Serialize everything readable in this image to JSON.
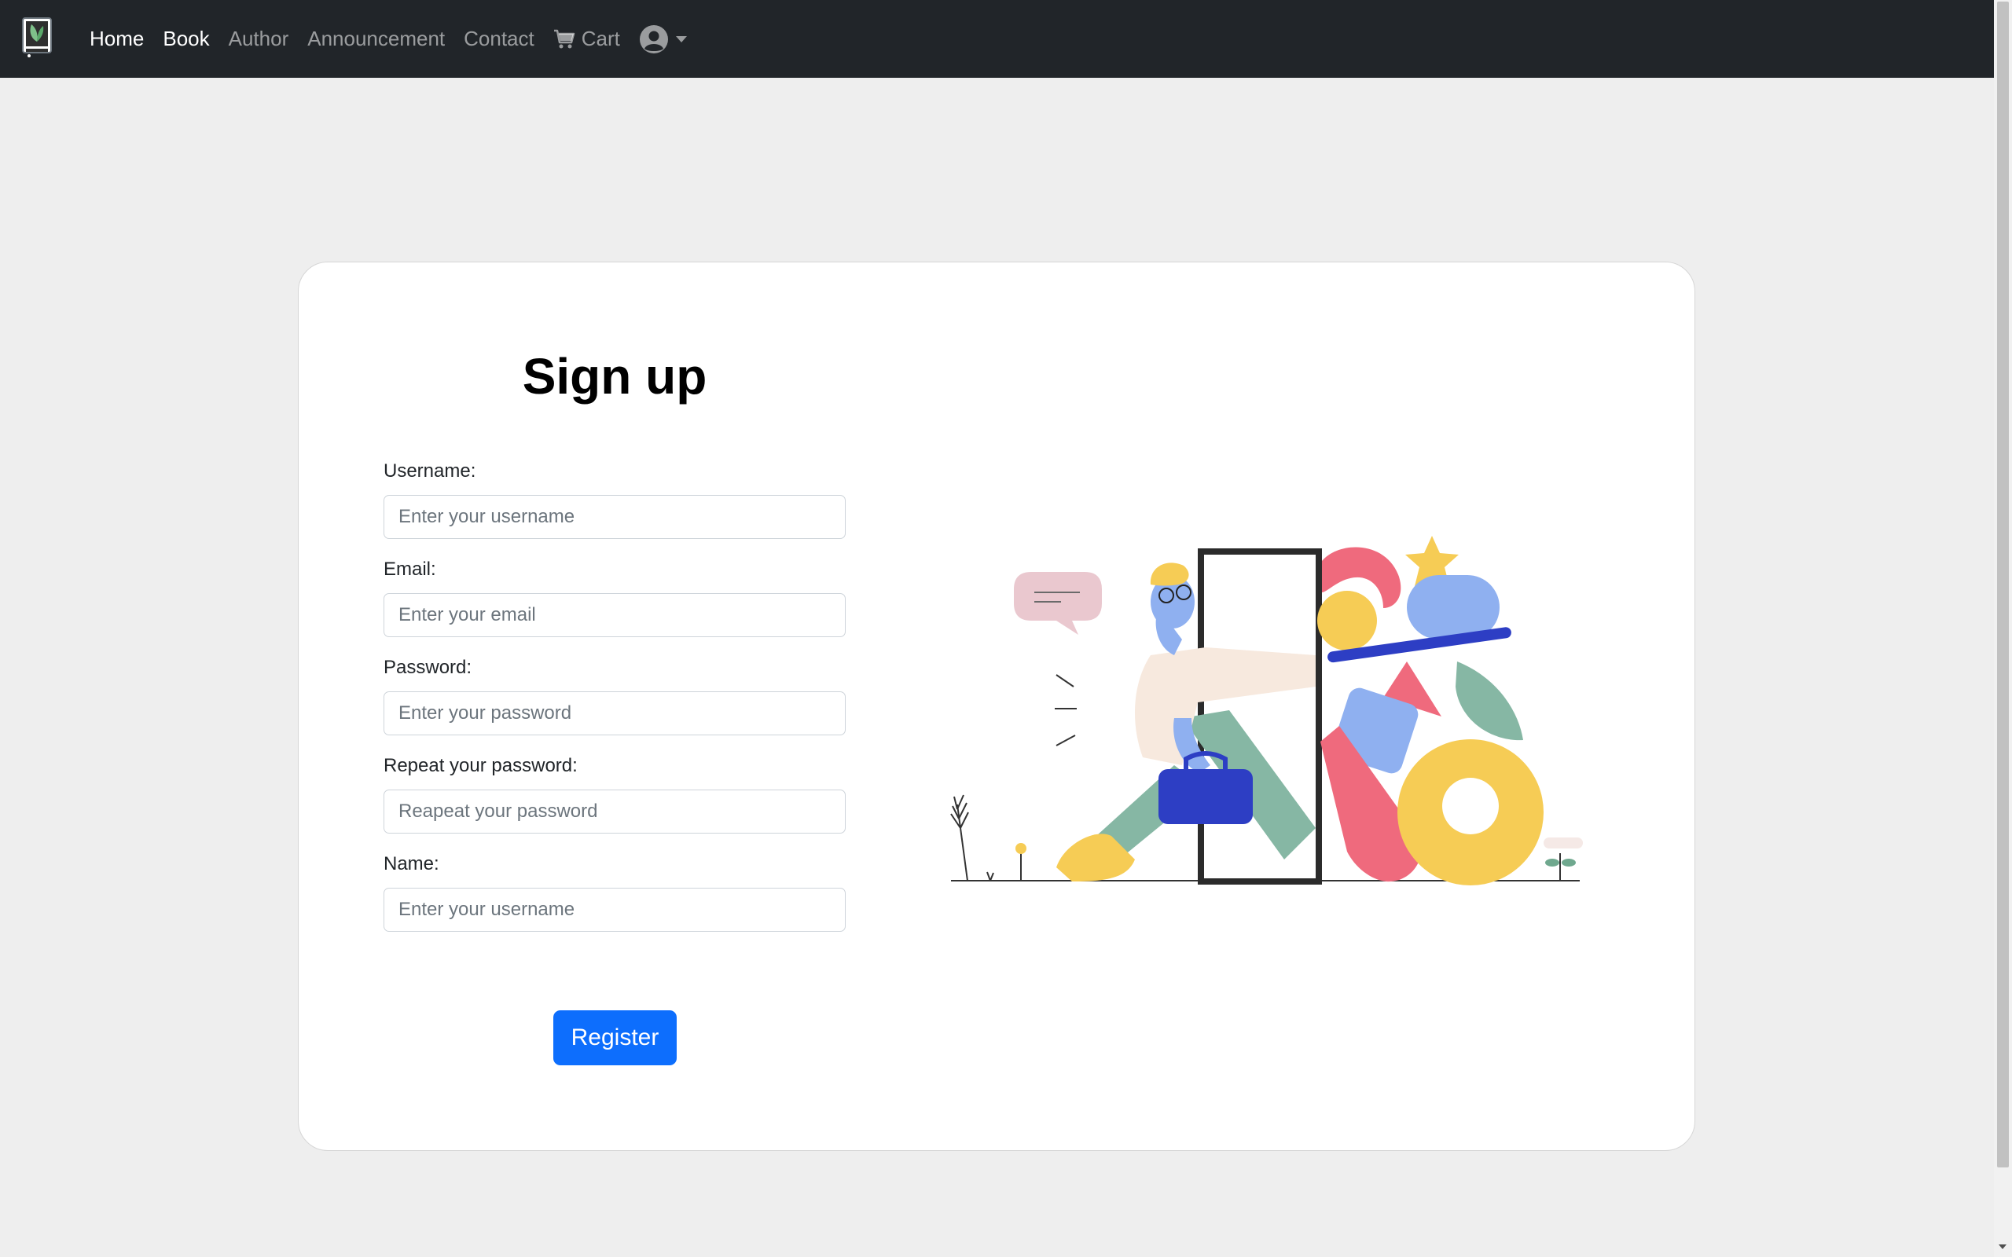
{
  "nav": {
    "brand_icon": "book-logo-icon",
    "links": [
      "Home",
      "Book",
      "Author",
      "Announcement",
      "Contact"
    ],
    "cart_label": "Cart",
    "cart_icon": "cart-icon",
    "user_icon": "user-circle-icon"
  },
  "signup": {
    "title": "Sign up",
    "fields": [
      {
        "label": "Username:",
        "placeholder": "Enter your username",
        "type": "text"
      },
      {
        "label": "Email:",
        "placeholder": "Enter your email",
        "type": "email"
      },
      {
        "label": "Password:",
        "placeholder": "Enter your password",
        "type": "password"
      },
      {
        "label": "Repeat your password:",
        "placeholder": "Reapeat your password",
        "type": "password"
      },
      {
        "label": "Name:",
        "placeholder": "Enter your username",
        "type": "text"
      }
    ],
    "register_label": "Register"
  },
  "colors": {
    "navbar_bg": "#212529",
    "page_bg": "#eeeeee",
    "primary": "#0d6efd"
  }
}
